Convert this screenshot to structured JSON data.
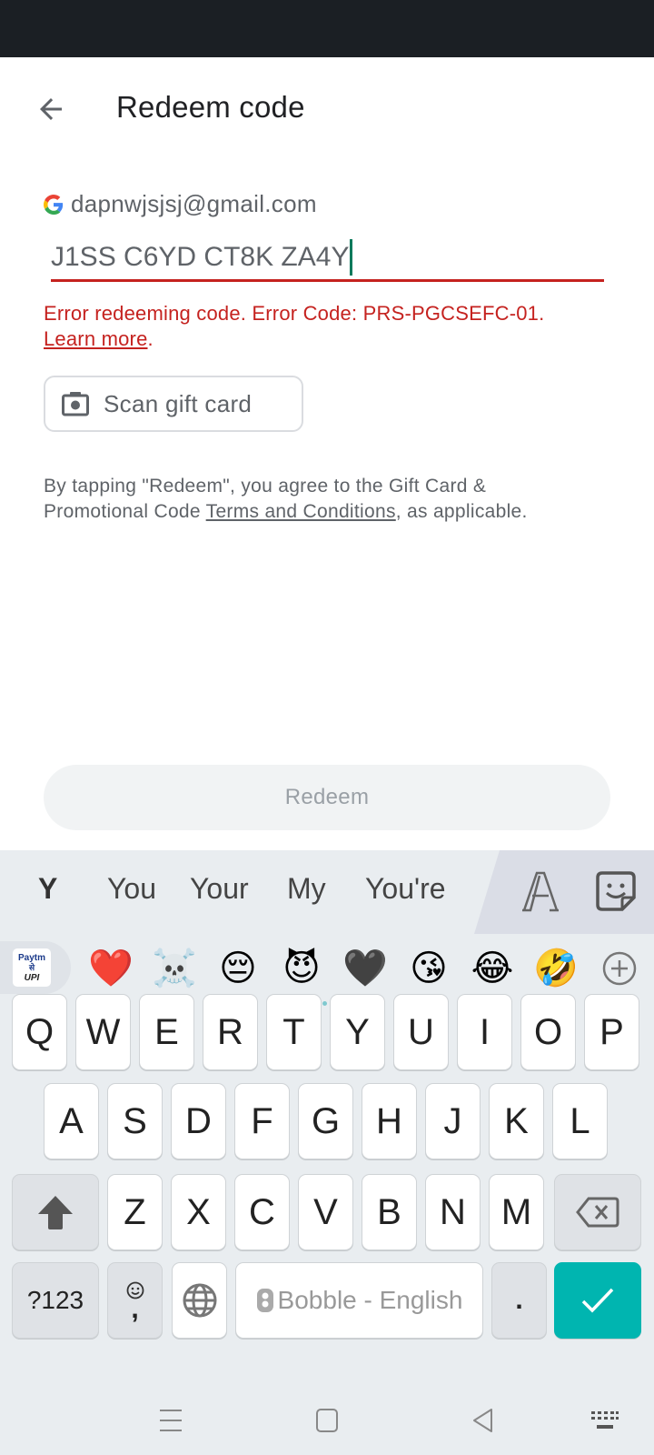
{
  "header": {
    "title": "Redeem code",
    "back_icon": "arrow-left-icon"
  },
  "account": {
    "icon": "google-g-icon",
    "email": "dapnwjsjsj@gmail.com"
  },
  "code_input": {
    "value": "J1SS C6YD CT8K ZA4Y"
  },
  "error": {
    "message": "Error redeeming code. Error Code: PRS-PGCSEFC-01.",
    "link": "Learn more",
    "suffix": ".",
    "color": "#c5221f"
  },
  "scan_button": {
    "icon": "camera-icon",
    "label": "Scan gift card"
  },
  "terms": {
    "prefix": "By tapping \"Redeem\", you agree to the Gift Card & Promotional Code ",
    "link": "Terms and Conditions",
    "suffix": ", as applicable."
  },
  "redeem_button": {
    "label": "Redeem",
    "state": "disabled"
  },
  "keyboard": {
    "suggestions": [
      "Y",
      "You",
      "Your",
      "My",
      "You're"
    ],
    "tools": [
      "font-style-icon",
      "sticker-icon"
    ],
    "paytm": {
      "top": "Paytm",
      "mid": "से",
      "bottom": "UPI"
    },
    "emojis": [
      "❤️",
      "☠️",
      "😔",
      "😈",
      "🖤",
      "😘",
      "😂",
      "🤣"
    ],
    "emoji_add_icon": "plus-circle-icon",
    "row1": [
      "Q",
      "W",
      "E",
      "R",
      "T",
      "Y",
      "U",
      "I",
      "O",
      "P"
    ],
    "row2": [
      "A",
      "S",
      "D",
      "F",
      "G",
      "H",
      "J",
      "K",
      "L"
    ],
    "row3": [
      "Z",
      "X",
      "C",
      "V",
      "B",
      "N",
      "M"
    ],
    "symbols_key": "?123",
    "comma_key": ",",
    "space_label": "Bobble - English",
    "period_key": ".",
    "enter_color": "#00b5b0"
  },
  "navbar": {
    "buttons": [
      "menu-icon",
      "home-square-icon",
      "back-triangle-icon",
      "keyboard-hide-icon"
    ]
  }
}
